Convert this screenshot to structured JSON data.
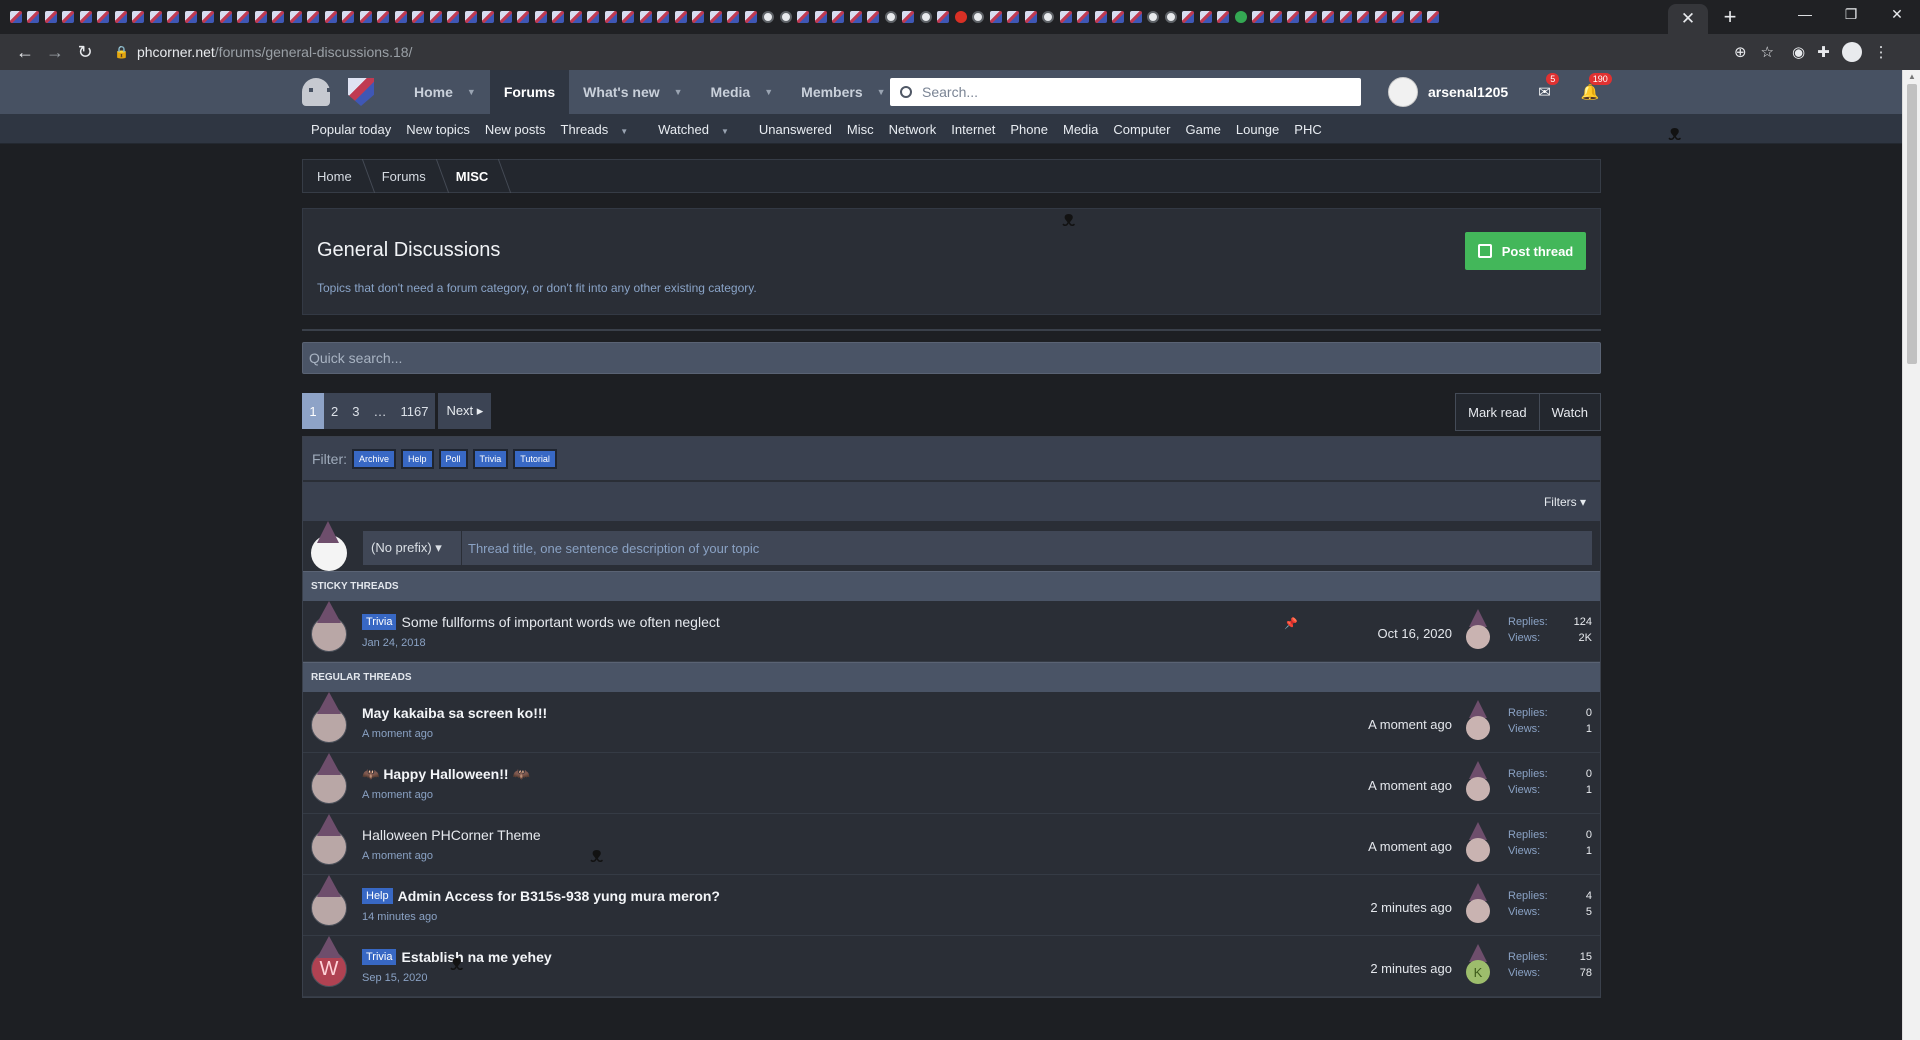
{
  "browser": {
    "tab_count_icons": 82,
    "active_tab_close": "✕",
    "new_tab": "+",
    "window_controls": [
      "—",
      "❐",
      "✕"
    ],
    "url_domain": "phcorner.net",
    "url_path": "/forums/general-discussions.18/"
  },
  "site": {
    "nav": [
      {
        "label": "Home",
        "caret": true
      },
      {
        "label": "Forums",
        "caret": false,
        "active": true
      },
      {
        "label": "What's new",
        "caret": true
      },
      {
        "label": "Media",
        "caret": true
      },
      {
        "label": "Members",
        "caret": true
      }
    ],
    "search_placeholder": "Search...",
    "username": "arsenal1205",
    "inbox_badge": "5",
    "alerts_badge": "190",
    "subnav": [
      "Popular today",
      "New topics",
      "New posts",
      "Threads",
      "Watched",
      "Unanswered",
      "Misc",
      "Network",
      "Internet",
      "Phone",
      "Media",
      "Computer",
      "Game",
      "Lounge",
      "PHC"
    ]
  },
  "breadcrumb": [
    "Home",
    "Forums",
    "MISC"
  ],
  "forum": {
    "title": "General Discussions",
    "description": "Topics that don't need a forum category, or don't fit into any other existing category.",
    "post_thread_label": "Post thread"
  },
  "quick_search_placeholder": "Quick search...",
  "pager": {
    "pages": [
      "1",
      "2",
      "3",
      "…",
      "1167"
    ],
    "next_label": "Next ▸",
    "mark_read": "Mark read",
    "watch": "Watch"
  },
  "filter": {
    "label": "Filter:",
    "tags": [
      "Archive",
      "Help",
      "Poll",
      "Trivia",
      "Tutorial"
    ],
    "filters_label": "Filters ▾"
  },
  "quick_thread": {
    "prefix": "(No prefix) ▾",
    "placeholder": "Thread title, one sentence description of your topic"
  },
  "sticky_header": "STICKY THREADS",
  "regular_header": "REGULAR THREADS",
  "sticky_threads": [
    {
      "prefix": "Trivia",
      "title": "Some fullforms of important words we often neglect",
      "meta": "Jan 24, 2018",
      "last": "Oct 16, 2020",
      "replies": "124",
      "views": "2K",
      "pinned": true
    }
  ],
  "threads": [
    {
      "prefix": "",
      "title": "May kakaiba sa screen ko!!!",
      "bold": true,
      "meta": "A moment ago",
      "last": "A moment ago",
      "replies": "0",
      "views": "1"
    },
    {
      "prefix": "",
      "title": "🦇 Happy Halloween!! 🦇",
      "bold": true,
      "meta": "A moment ago",
      "last": "A moment ago",
      "replies": "0",
      "views": "1"
    },
    {
      "prefix": "",
      "title": "Halloween PHCorner Theme",
      "bold": false,
      "meta": "A moment ago",
      "last": "A moment ago",
      "replies": "0",
      "views": "1"
    },
    {
      "prefix": "Help",
      "title": "Admin Access for B315s-938 yung mura meron?",
      "bold": true,
      "meta": "14 minutes ago",
      "last": "2 minutes ago",
      "replies": "4",
      "views": "5"
    },
    {
      "prefix": "Trivia",
      "title": "Establish na me yehey",
      "bold": true,
      "meta": "Sep 15, 2020",
      "last": "2 minutes ago",
      "replies": "15",
      "views": "78",
      "author_letter": "W",
      "last_letter": "K"
    }
  ],
  "labels": {
    "replies": "Replies:",
    "views": "Views:"
  }
}
